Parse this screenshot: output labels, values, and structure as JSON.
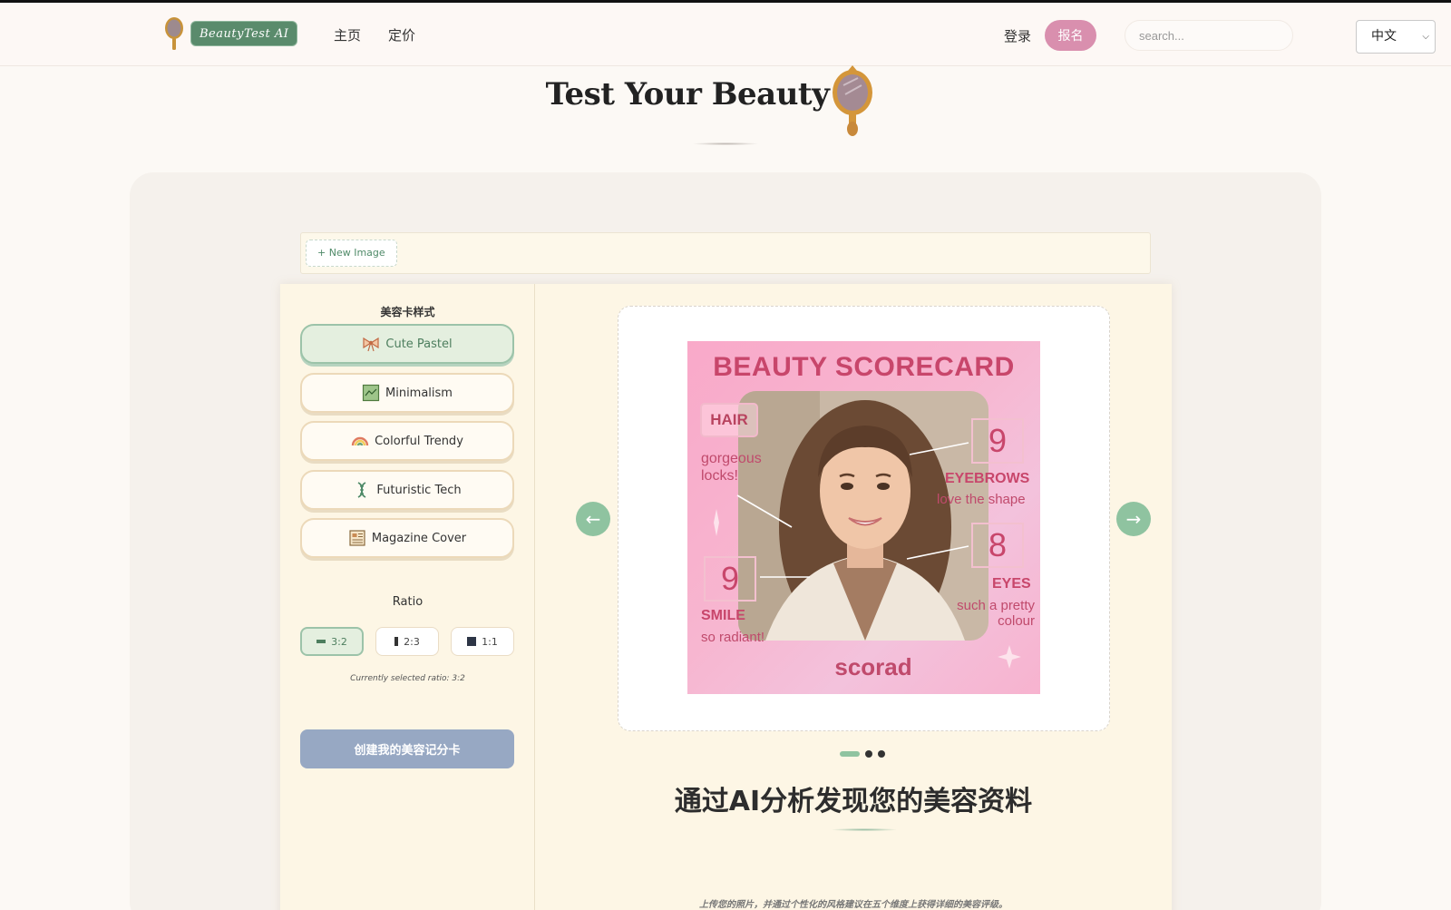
{
  "header": {
    "logo_text": "BeautyTest AI",
    "nav": [
      "主页",
      "定价"
    ],
    "login": "登录",
    "signup": "报名",
    "search_placeholder": "search...",
    "language": "中文"
  },
  "page_title": "Test Your Beauty",
  "toolbar": {
    "new_image": "+ New Image"
  },
  "sidebar": {
    "style_heading": "美容卡样式",
    "styles": [
      {
        "label": "Cute Pastel",
        "icon": "bow-icon",
        "active": true
      },
      {
        "label": "Minimalism",
        "icon": "landscape-icon",
        "active": false
      },
      {
        "label": "Colorful Trendy",
        "icon": "rainbow-icon",
        "active": false
      },
      {
        "label": "Futuristic Tech",
        "icon": "dna-icon",
        "active": false
      },
      {
        "label": "Magazine Cover",
        "icon": "newspaper-icon",
        "active": false
      }
    ],
    "ratio_heading": "Ratio",
    "ratios": [
      {
        "label": "3:2",
        "active": true
      },
      {
        "label": "2:3",
        "active": false
      },
      {
        "label": "1:1",
        "active": false
      }
    ],
    "ratio_note": "Currently selected ratio: 3:2",
    "create_button": "创建我的美容记分卡"
  },
  "scorecard": {
    "title": "BEAUTY SCORECARD",
    "hair_label": "HAIR",
    "hair_comment_1": "gorgeous",
    "hair_comment_2": "locks!",
    "eyebrows_score": "9",
    "eyebrows_label": "EYEBROWS",
    "eyebrows_comment": "love the shape",
    "eyes_score": "8",
    "eyes_label": "EYES",
    "eyes_comment_1": "such a pretty",
    "eyes_comment_2": "colour",
    "smile_score": "9",
    "smile_label": "SMILE",
    "smile_comment": "so radiant!",
    "footer": "scorad"
  },
  "carousel": {
    "prev": "←",
    "next": "→",
    "slides": 3,
    "current": 1
  },
  "headline": "通过AI分析发现您的美容资料",
  "subtext": "上传您的照片，并通过个性化的风格建议在五个维度上获得详细的美容评级。",
  "colors": {
    "accent_green": "#8fc3a0",
    "accent_pink": "#d98fae",
    "card_pink": "#f7b6d0",
    "score_red": "#c8466b",
    "create_button": "#97a8c3"
  }
}
